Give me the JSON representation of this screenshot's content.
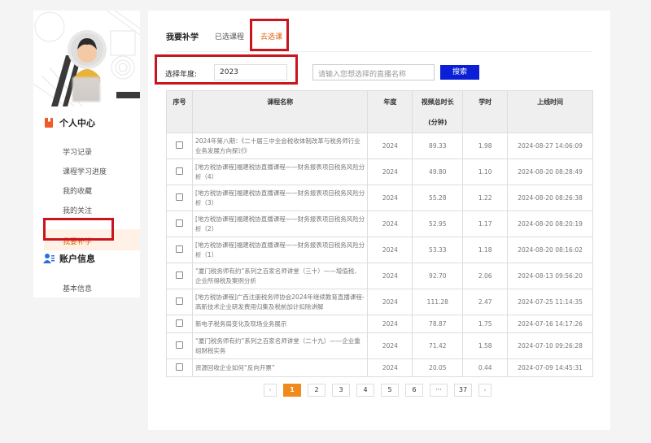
{
  "sidebar": {
    "personal_center": "个人中心",
    "links": [
      "学习记录",
      "课程学习进度",
      "我的收藏",
      "我的关注"
    ],
    "active_link": "我要补学",
    "account_info": "账户信息",
    "basic_info": "基本信息"
  },
  "tabs": [
    "我要补学",
    "已选课程",
    "去选课"
  ],
  "filter": {
    "year_label": "选择年度:",
    "year_value": "2023",
    "search_placeholder": "请输入您想选择的直播名称",
    "search_button": "搜索"
  },
  "table": {
    "headers": [
      "序号",
      "课程名称",
      "年度",
      "视频总时长\n(分钟)",
      "学时",
      "上线时间"
    ],
    "header_duration_line1": "视频总时长",
    "header_duration_line2": "(分钟)",
    "rows": [
      {
        "name": "2024年第八期：《二十届三中全会税收体制改革与税务师行业业务发展方向探讨》",
        "year": "2024",
        "duration": "89.33",
        "hours": "1.98",
        "time": "2024-08-27 14:06:09"
      },
      {
        "name": "[地方税协课程]福建税协直播课程——财务报表项目税务风险分析（4）",
        "year": "2024",
        "duration": "49.80",
        "hours": "1.10",
        "time": "2024-08-20 08:28:49"
      },
      {
        "name": "[地方税协课程]福建税协直播课程——财务报表项目税务风险分析（3）",
        "year": "2024",
        "duration": "55.28",
        "hours": "1.22",
        "time": "2024-08-20 08:26:38"
      },
      {
        "name": "[地方税协课程]福建税协直播课程——财务报表项目税务风险分析（2）",
        "year": "2024",
        "duration": "52.95",
        "hours": "1.17",
        "time": "2024-08-20 08:20:19"
      },
      {
        "name": "[地方税协课程]福建税协直播课程——财务报表项目税务风险分析（1）",
        "year": "2024",
        "duration": "53.33",
        "hours": "1.18",
        "time": "2024-08-20 08:16:02"
      },
      {
        "name": "“厦门税务师有约”系列之百家名师讲堂（三十）——增值税、企业所得税及案例分析",
        "year": "2024",
        "duration": "92.70",
        "hours": "2.06",
        "time": "2024-08-13 09:56:20"
      },
      {
        "name": "[地方税协课程]广西注册税务师协会2024年继续教育直播课程-高新技术企业研发费用归集及税前加计扣除讲解",
        "year": "2024",
        "duration": "111.28",
        "hours": "2.47",
        "time": "2024-07-25 11:14:35"
      },
      {
        "name": "新电子税务局变化及现场业务展示",
        "year": "2024",
        "duration": "78.87",
        "hours": "1.75",
        "time": "2024-07-16 14:17:26"
      },
      {
        "name": "“厦门税务师有约”系列之百家名师讲堂（二十九）——企业重组财税实务",
        "year": "2024",
        "duration": "71.42",
        "hours": "1.58",
        "time": "2024-07-10 09:26:28"
      },
      {
        "name": "资源回收企业如何“反向开票”",
        "year": "2024",
        "duration": "20.05",
        "hours": "0.44",
        "time": "2024-07-09 14:45:31"
      }
    ]
  },
  "pagination": {
    "prev": "‹",
    "pages": [
      "1",
      "2",
      "3",
      "4",
      "5",
      "6",
      "···",
      "37"
    ],
    "next": "›",
    "current": "1"
  },
  "colors": {
    "accent": "#e0620d",
    "search_button": "#0a1fd6",
    "highlight_box": "#c9151e"
  },
  "icons": [
    "bookmark-icon",
    "user-list-icon",
    "avatar"
  ]
}
